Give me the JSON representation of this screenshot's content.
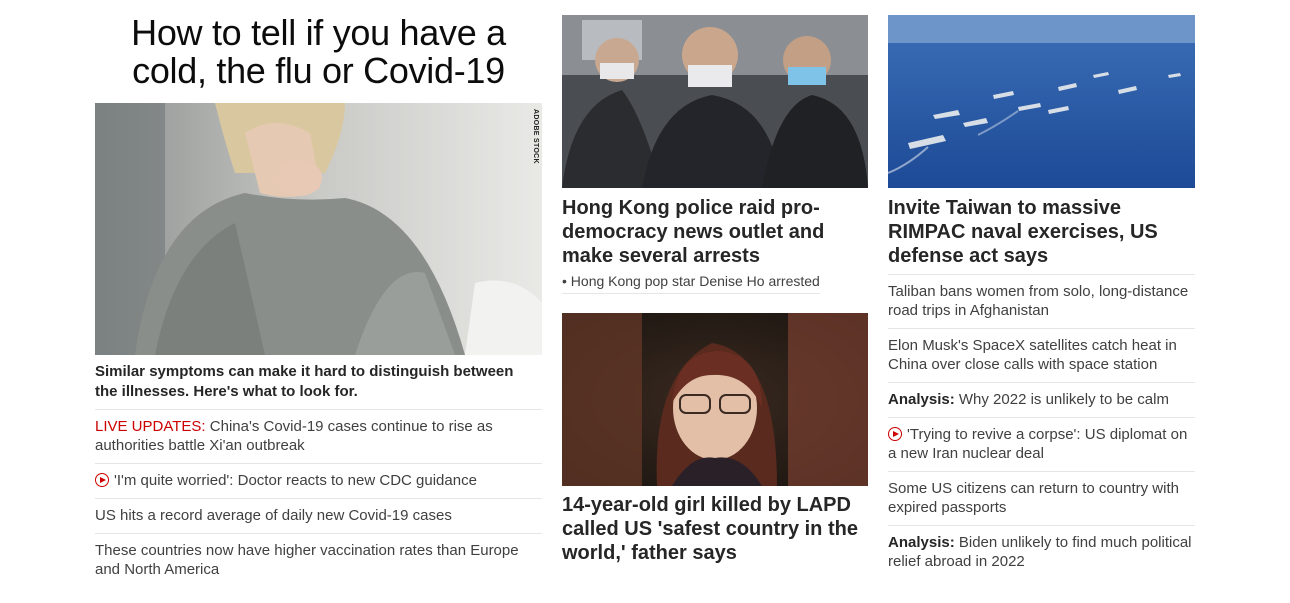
{
  "column1": {
    "headline": "How to tell if you have a cold, the flu or Covid-19",
    "image_credit": "ADOBE STOCK",
    "description": "Similar symptoms can make it hard to distinguish between the illnesses. Here's what to look for.",
    "items": [
      {
        "prefix": "LIVE UPDATES: ",
        "text": "China's Covid-19 cases continue to rise as authorities battle Xi'an outbreak"
      },
      {
        "video": true,
        "text": "'I'm quite worried': Doctor reacts to new CDC guidance"
      },
      {
        "text": "US hits a record average of daily new Covid-19 cases"
      },
      {
        "text": "These countries now have higher vaccination rates than Europe and North America"
      }
    ]
  },
  "column2": {
    "card1_title": "Hong Kong police raid pro-democracy news outlet and make several arrests",
    "card1_sublink": "• Hong Kong pop star Denise Ho arrested",
    "card2_title": "14-year-old girl killed by LAPD called US 'safest country in the world,' father says"
  },
  "column3": {
    "card_title": "Invite Taiwan to massive RIMPAC naval exercises, US defense act says",
    "items": [
      {
        "text": "Taliban bans women from solo, long-distance road trips in Afghanistan"
      },
      {
        "text": "Elon Musk's SpaceX satellites catch heat in China over close calls with space station"
      },
      {
        "prefix": "Analysis: ",
        "text": "Why 2022 is unlikely to be calm"
      },
      {
        "video": true,
        "text": "'Trying to revive a corpse': US diplomat on a new Iran nuclear deal"
      },
      {
        "text": "Some US citizens can return to country with expired passports"
      },
      {
        "prefix": "Analysis: ",
        "text": "Biden unlikely to find much political relief abroad in 2022"
      }
    ]
  }
}
